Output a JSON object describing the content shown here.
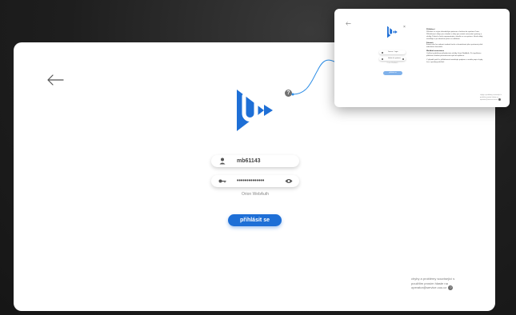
{
  "login": {
    "username_value": "mb61143",
    "password_value": "••••••••••••••",
    "auth_label": "Orion WebAuth",
    "submit_label": "přihlásit se",
    "help_badge": "?"
  },
  "support": {
    "text": "chyby a problémy související s použitím prosím hlaste na operator@service.cuu.cz",
    "help_badge": "?"
  },
  "help_popup": {
    "close_label": "×",
    "username_value": "Jmeno - Login",
    "password_value": "Heslo do systemu",
    "auth_label": "Orion WebAuth",
    "submit_label": "přihlásit se",
    "heading_1": "Přihlášení",
    "paragraph_1": "Přihlaste se svým uživatelským jménem a heslem do systému Orion. Přihlašovací údaje jsou shodné s údaji pro ostatní univerzitní systémy a služby. Pokud si heslo nepamatujete, obraťte se na správce. Heslo nikdy nesdílejte a po ukončení práce se odhlaste.",
    "heading_2": "Zobrazit",
    "paragraph_2": "Ikonou oka lze zobrazit zadané heslo a zkontrolovat jeho správnost před odesláním formuláře.",
    "heading_3": "WebAuth autentizace",
    "paragraph_3": "Ověření probíhá prostřednictvím služby Orion WebAuth. Po úspěšném přihlášení budete přesměrováni zpět do aplikace.",
    "paragraph_4": "V případě potíží s přihlášením kontaktujte podporu a uveďte popis chyby, čas a použitý prohlížeč.",
    "support_text": "chyby a problémy související s použitím prosím hlaste na operator@service.cuu.cz"
  },
  "colors": {
    "brand_blue": "#1e6fd6",
    "connector_blue": "#2e8ee6"
  }
}
